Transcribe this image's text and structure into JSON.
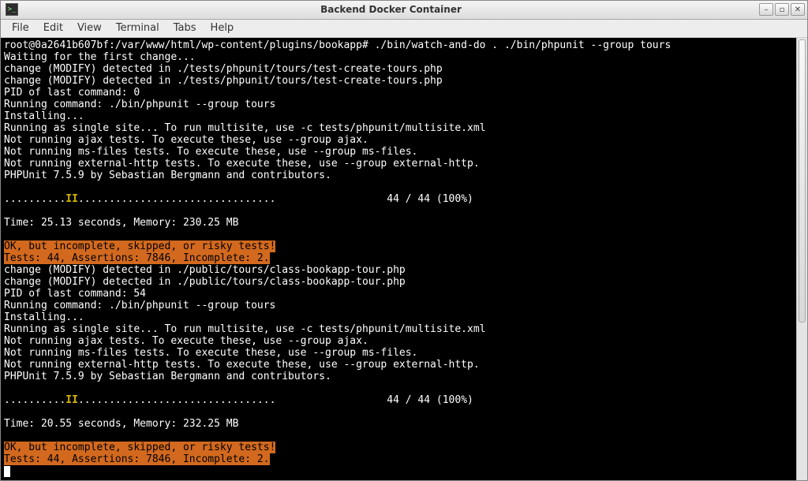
{
  "window": {
    "title": "Backend Docker Container"
  },
  "menubar": {
    "items": [
      "File",
      "Edit",
      "View",
      "Terminal",
      "Tabs",
      "Help"
    ]
  },
  "win_btn": {
    "min": "–",
    "max": "▫",
    "close": "✕"
  },
  "t": {
    "prompt": "root@0a2641b607bf:/var/www/html/wp-content/plugins/bookapp# ./bin/watch-and-do . ./bin/phpunit --group tours",
    "waiting": "Waiting for the first change...",
    "chg1": "change (MODIFY) detected in ./tests/phpunit/tours/test-create-tours.php",
    "pid0": "PID of last command: 0",
    "runcmd": "Running command: ./bin/phpunit --group tours",
    "inst": "Installing...",
    "single": "Running as single site... To run multisite, use -c tests/phpunit/multisite.xml",
    "ajax": "Not running ajax tests. To execute these, use --group ajax.",
    "msfiles": "Not running ms-files tests. To execute these, use --group ms-files.",
    "exthttp": "Not running external-http tests. To execute these, use --group external-http.",
    "phpunit": "PHPUnit 7.5.9 by Sebastian Bergmann and contributors.",
    "dots_a": "..........",
    "ii": "II",
    "dots_b": "................................                  44 / 44 (100%)",
    "time1": "Time: 25.13 seconds, Memory: 230.25 MB",
    "ok": "OK, but incomplete, skipped, or risky tests!",
    "tests": "Tests: 44, Assertions: 7846, Incomplete: 2.",
    "chg2": "change (MODIFY) detected in ./public/tours/class-bookapp-tour.php",
    "pid54": "PID of last command: 54",
    "time2": "Time: 20.55 seconds, Memory: 232.25 MB"
  }
}
